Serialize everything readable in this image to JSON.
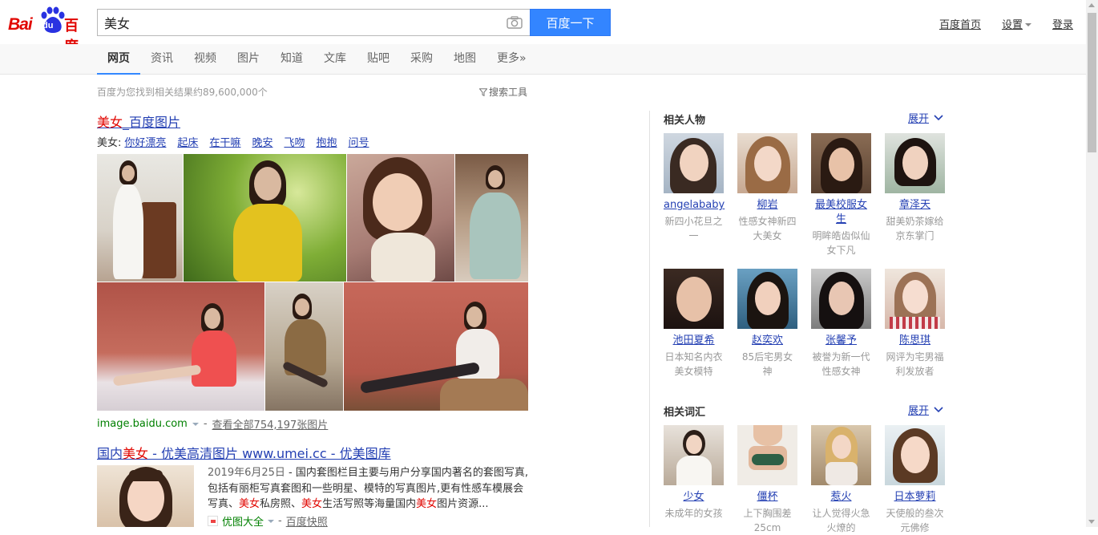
{
  "header": {
    "logo_bai": "Bai",
    "logo_du": "du",
    "logo_cn": "百度",
    "query": "美女",
    "search_button": "百度一下",
    "links": [
      "百度首页",
      "设置",
      "登录"
    ]
  },
  "nav": {
    "tabs": [
      "网页",
      "资讯",
      "视频",
      "图片",
      "知道",
      "文库",
      "贴吧",
      "采购",
      "地图",
      "更多»"
    ],
    "active": "网页"
  },
  "stats": {
    "result_count": "百度为您找到相关结果约89,600,000个",
    "search_tools": "搜索工具"
  },
  "result1": {
    "title_hl": "美女",
    "title_rest": "_百度图片",
    "related_label": "美女:",
    "related": [
      "你好漂亮",
      "起床",
      "在干嘛",
      "晚安",
      "飞吻",
      "抱抱",
      "问号"
    ],
    "source_url": "image.baidu.com",
    "view_all": "查看全部754,197张图片"
  },
  "result2": {
    "title_a": "国内",
    "title_hl": "美女",
    "title_b": " - 优美高清图片 www.umei.cc - 优美图库",
    "date": "2019年6月25日",
    "abstract_1": " - 国内套图栏目主要与用户分享国内著名的套图写真,包括有丽柜写真套图和一些明星、模特的写真图片,更有性感车模展会写真、",
    "hl1": "美女",
    "abstract_2": "私房照、",
    "hl2": "美女",
    "abstract_3": "生活写照等海量国内",
    "hl3": "美女",
    "abstract_4": "图片资源...",
    "site": "优图大全",
    "snapshot": "百度快照"
  },
  "related_people": {
    "title": "相关人物",
    "expand": "展开",
    "items": [
      {
        "name": "angelababy",
        "desc": "新四小花旦之一"
      },
      {
        "name": "柳岩",
        "desc": "性感女神新四大美女"
      },
      {
        "name": "最美校服女生",
        "desc": "明眸皓齿似仙女下凡"
      },
      {
        "name": "章泽天",
        "desc": "甜美奶茶嫁给京东掌门"
      },
      {
        "name": "池田夏希",
        "desc": "日本知名内衣美女模特"
      },
      {
        "name": "赵奕欢",
        "desc": "85后宅男女神"
      },
      {
        "name": "张馨予",
        "desc": "被誉为新一代性感女神"
      },
      {
        "name": "陈思琪",
        "desc": "网评为宅男福利发放者"
      }
    ]
  },
  "related_terms": {
    "title": "相关词汇",
    "expand": "展开",
    "items": [
      {
        "name": "少女",
        "desc": "未成年的女孩"
      },
      {
        "name": "僵杯",
        "desc": "上下胸围差25cm"
      },
      {
        "name": "惹火",
        "desc": "让人觉得火急火燎的"
      },
      {
        "name": "日本萝莉",
        "desc": "天使般的叁次元佛修"
      }
    ]
  },
  "colors": {
    "brand_red": "#e10601",
    "brand_blue": "#2932e1",
    "button_blue": "#3385ff",
    "link_blue": "#2440b3",
    "url_green": "#008000"
  }
}
